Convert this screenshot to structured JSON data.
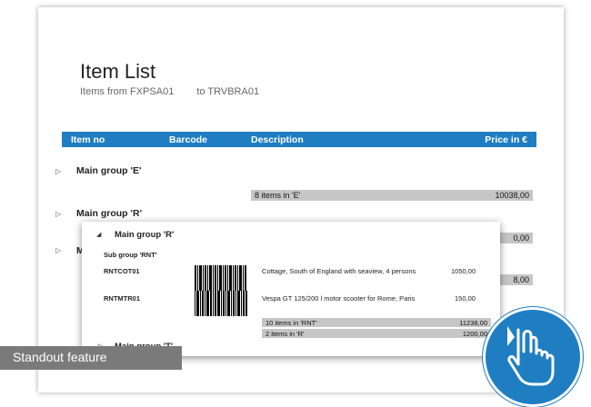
{
  "report": {
    "title": "Item List",
    "subtitle_from": "Items from FXPSA01",
    "subtitle_to": "to TRVBRA01",
    "columns": {
      "item_no": "Item no",
      "barcode": "Barcode",
      "description": "Description",
      "price": "Price in €"
    },
    "groups": [
      {
        "label": "Main group 'E'",
        "summary_label": "8 items in 'E'",
        "summary_value": "10038,00"
      },
      {
        "label": "Main group 'R'",
        "summary_value": "0,00"
      },
      {
        "label": "M",
        "summary_value": "8,00"
      }
    ],
    "accent_color": "#1f7ec2"
  },
  "popup": {
    "group_label": "Main group 'R'",
    "sub_group_label": "Sub group 'RNT'",
    "rows": [
      {
        "item_no": "RNTCOT01",
        "description": "Cottage, South of England with seaview, 4 persons",
        "price": "1050,00"
      },
      {
        "item_no": "RNTMTR01",
        "description": "Vespa GT 125/200 l motor scooter for Rome, Paris",
        "price": "150,00"
      }
    ],
    "summary_sub_label": "10 items in 'RNT'",
    "summary_sub_value": "11238,00",
    "summary_group_label": "2 items in 'R'",
    "summary_group_value": "1200,00",
    "next_group_label": "Main group 'T'"
  },
  "feature_badge": {
    "label": "Standout feature",
    "color": "#7a7a7a"
  },
  "cursor_badge": {
    "icon": "hand-pointer-icon",
    "color": "#1f7ec2"
  }
}
